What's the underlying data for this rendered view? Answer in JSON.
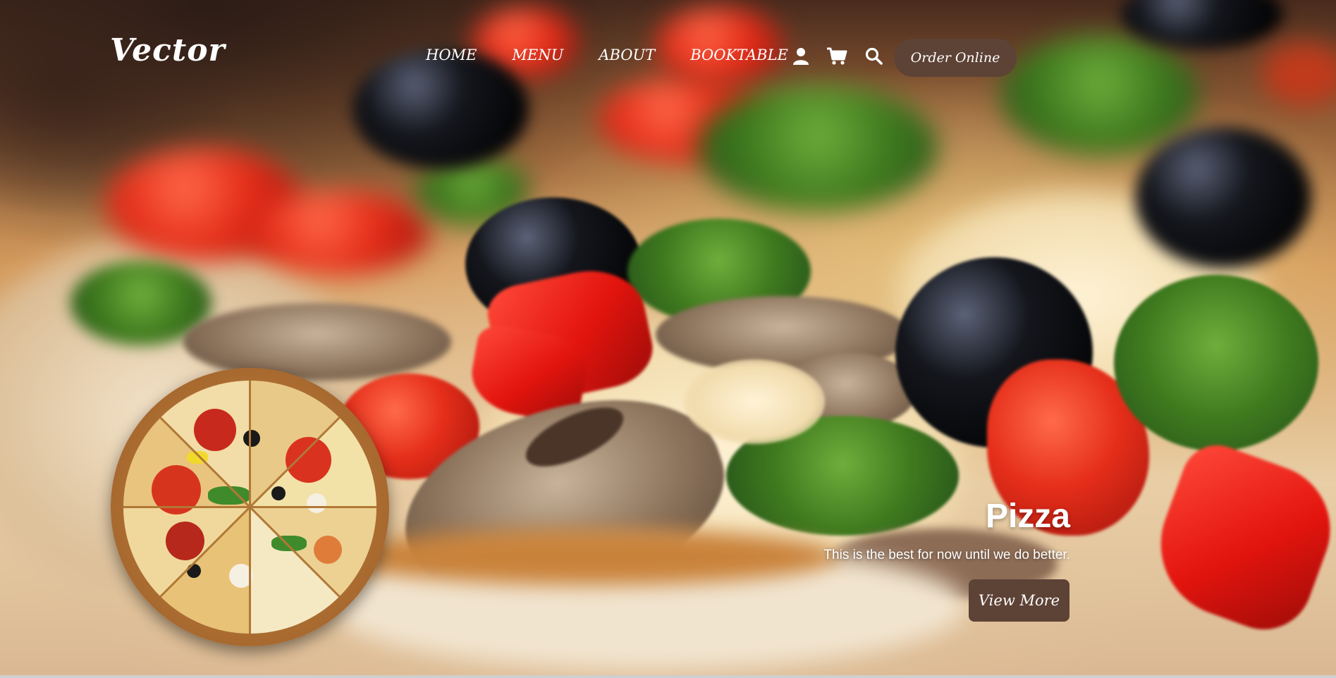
{
  "brand": {
    "logo_text": "Vector"
  },
  "nav": {
    "links": [
      "HOME",
      "MENU",
      "ABOUT",
      "BOOKTABLE"
    ],
    "icons": [
      "user-icon",
      "cart-icon",
      "search-icon"
    ],
    "order_button": "Order Online"
  },
  "hero": {
    "title": "Pizza",
    "subtitle": "This is the best for now until we do better.",
    "button": "View More"
  },
  "colors": {
    "button_bg": "#5d4236",
    "text": "#ffffff"
  }
}
